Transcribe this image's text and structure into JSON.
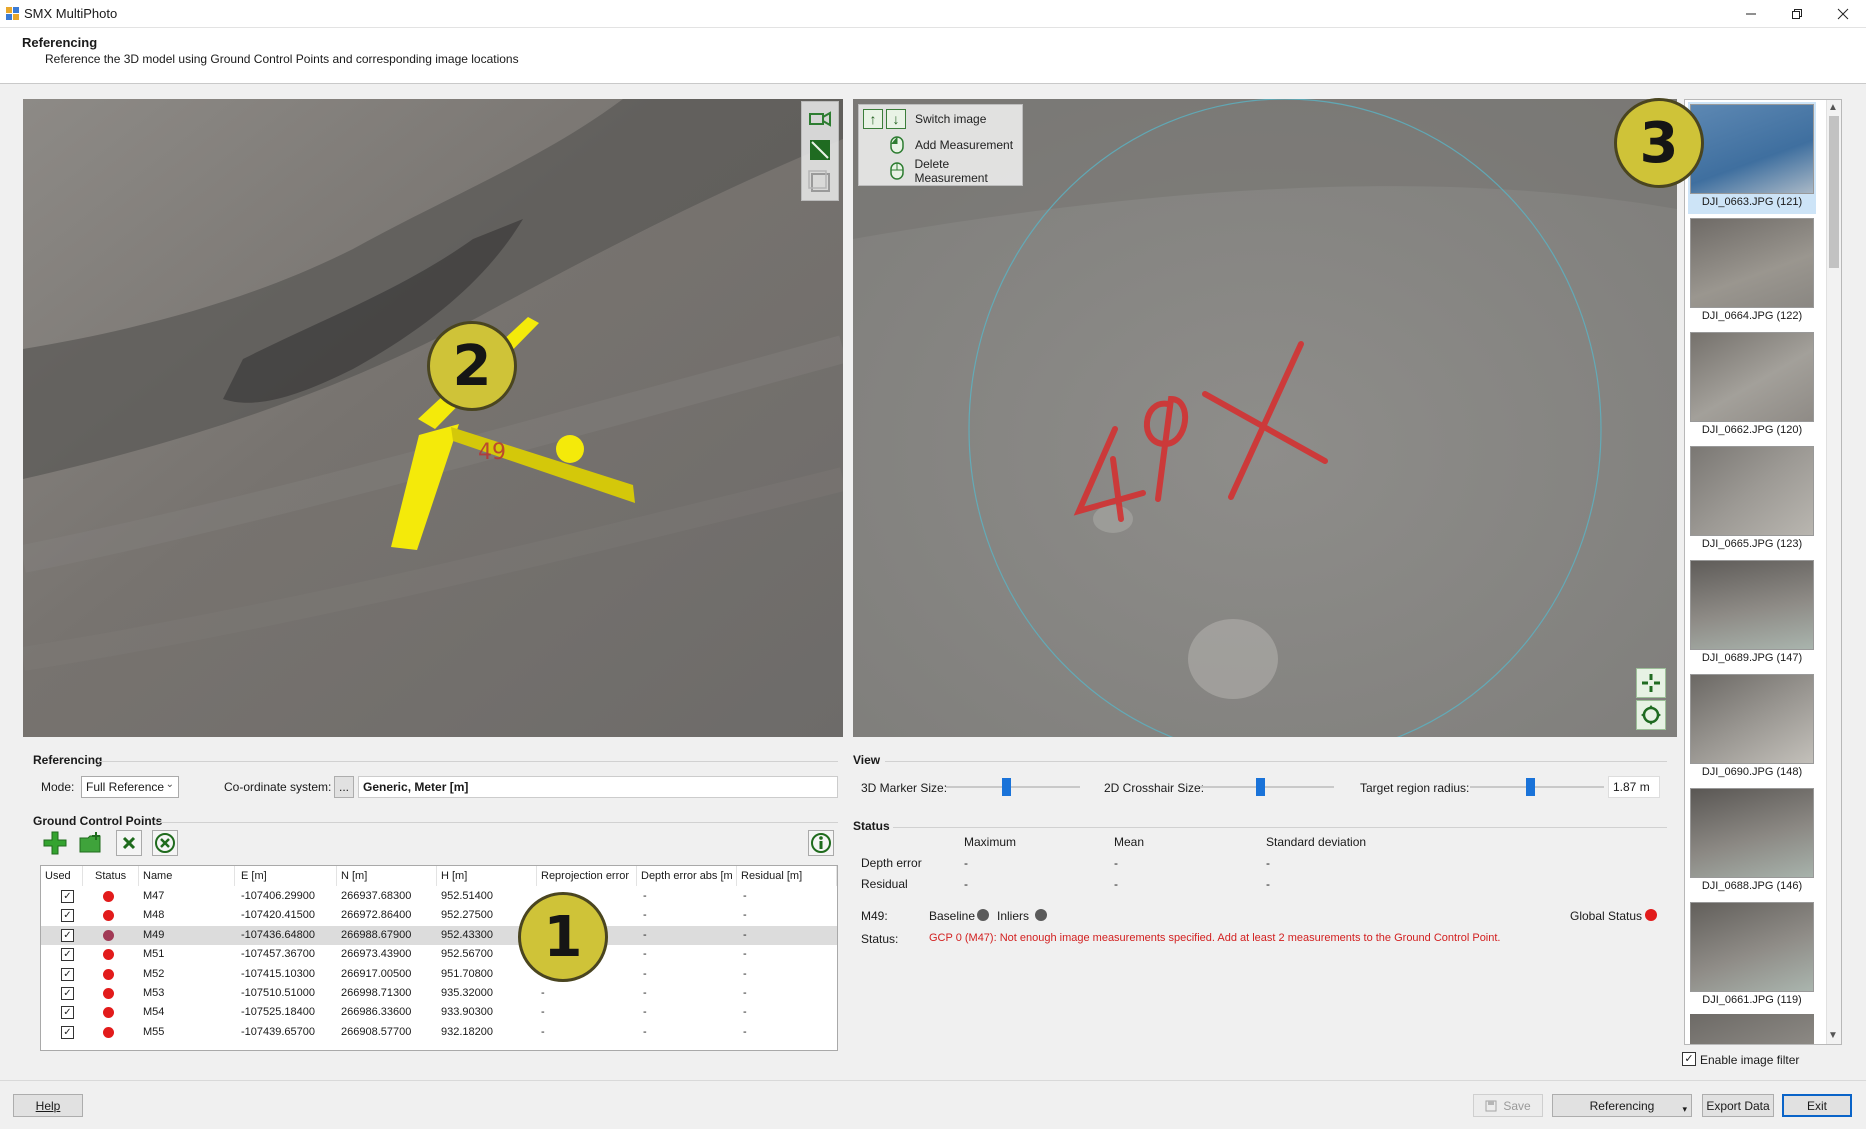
{
  "window": {
    "title": "SMX MultiPhoto"
  },
  "header": {
    "title": "Referencing",
    "subtitle": "Reference the 3D model using Ground Control Points and corresponding image locations"
  },
  "viewport3d": {
    "badge": "2"
  },
  "viewport2d": {
    "legend": {
      "switch": "Switch image",
      "add": "Add Measurement",
      "delete": "Delete Measurement"
    }
  },
  "thumbnails": {
    "badge": "3",
    "items": [
      {
        "label": "DJI_0663.JPG (121)"
      },
      {
        "label": "DJI_0664.JPG (122)"
      },
      {
        "label": "DJI_0662.JPG (120)"
      },
      {
        "label": "DJI_0665.JPG (123)"
      },
      {
        "label": "DJI_0689.JPG (147)"
      },
      {
        "label": "DJI_0690.JPG (148)"
      },
      {
        "label": "DJI_0688.JPG (146)"
      },
      {
        "label": "DJI_0661.JPG (119)"
      }
    ],
    "filter_label": "Enable image filter"
  },
  "referencing": {
    "title": "Referencing",
    "mode_label": "Mode:",
    "mode_value": "Full Reference",
    "coord_label": "Co-ordinate system:",
    "coord_button": "...",
    "coord_value": "Generic, Meter [m]"
  },
  "gcp": {
    "title": "Ground Control Points",
    "badge": "1",
    "columns": [
      "Used",
      "Status",
      "Name",
      "E [m]",
      "N [m]",
      "H [m]",
      "Reprojection error",
      "Depth error abs [m",
      "Residual [m]"
    ],
    "rows": [
      {
        "name": "M47",
        "e": "-107406.29900",
        "n": "266937.68300",
        "h": "952.51400",
        "rep": "",
        "depth": "-",
        "res": "-",
        "status_color": "#e21b1b"
      },
      {
        "name": "M48",
        "e": "-107420.41500",
        "n": "266972.86400",
        "h": "952.27500",
        "rep": "",
        "depth": "-",
        "res": "-",
        "status_color": "#e21b1b"
      },
      {
        "name": "M49",
        "e": "-107436.64800",
        "n": "266988.67900",
        "h": "952.43300",
        "rep": "",
        "depth": "-",
        "res": "-",
        "status_color": "#a13a56"
      },
      {
        "name": "M51",
        "e": "-107457.36700",
        "n": "266973.43900",
        "h": "952.56700",
        "rep": "",
        "depth": "-",
        "res": "-",
        "status_color": "#e21b1b"
      },
      {
        "name": "M52",
        "e": "-107415.10300",
        "n": "266917.00500",
        "h": "951.70800",
        "rep": "",
        "depth": "-",
        "res": "-",
        "status_color": "#e21b1b"
      },
      {
        "name": "M53",
        "e": "-107510.51000",
        "n": "266998.71300",
        "h": "935.32000",
        "rep": "-",
        "depth": "-",
        "res": "-",
        "status_color": "#e21b1b"
      },
      {
        "name": "M54",
        "e": "-107525.18400",
        "n": "266986.33600",
        "h": "933.90300",
        "rep": "-",
        "depth": "-",
        "res": "-",
        "status_color": "#e21b1b"
      },
      {
        "name": "M55",
        "e": "-107439.65700",
        "n": "266908.57700",
        "h": "932.18200",
        "rep": "-",
        "depth": "-",
        "res": "-",
        "status_color": "#e21b1b"
      }
    ]
  },
  "view": {
    "title": "View",
    "marker_label": "3D Marker Size:",
    "marker_value": 0.45,
    "crosshair_label": "2D Crosshair Size:",
    "crosshair_value": 0.45,
    "radius_label": "Target region radius:",
    "radius_slider": 0.45,
    "radius_value": "1.87 m"
  },
  "status": {
    "title": "Status",
    "columns": [
      "Maximum",
      "Mean",
      "Standard deviation"
    ],
    "rows": [
      {
        "label": "Depth error",
        "max": "-",
        "mean": "-",
        "std": "-"
      },
      {
        "label": "Residual",
        "max": "-",
        "mean": "-",
        "std": "-"
      }
    ],
    "gcp_label": "M49:",
    "baseline_label": "Baseline",
    "inliers_label": "Inliers",
    "global_label": "Global Status",
    "status_label": "Status:",
    "message": "GCP 0 (M47): Not enough image measurements specified. Add at least 2 measurements to the Ground Control Point.",
    "colors": {
      "grey": "#5a5a5a",
      "red": "#e21b1b",
      "message": "#d21f1f"
    }
  },
  "footer": {
    "help": "Help",
    "save": "Save",
    "referencing": "Referencing",
    "export": "Export Data",
    "exit": "Exit"
  }
}
